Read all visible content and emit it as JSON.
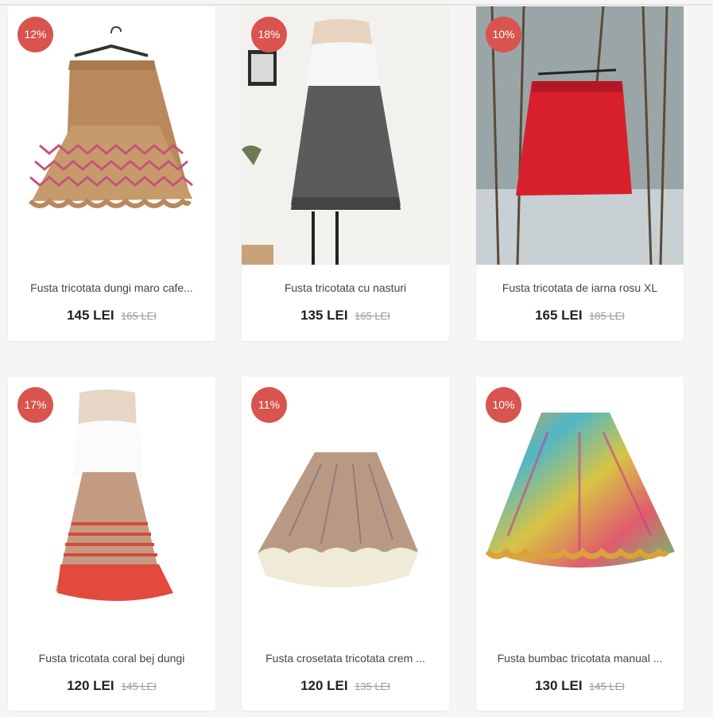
{
  "products": [
    {
      "discount": "12%",
      "title": "Fusta tricotata dungi maro cafe...",
      "price": "145 LEI",
      "old_price": "165 LEI"
    },
    {
      "discount": "18%",
      "title": "Fusta tricotata cu nasturi",
      "price": "135 LEI",
      "old_price": "165 LEI"
    },
    {
      "discount": "10%",
      "title": "Fusta tricotata de iarna rosu XL",
      "price": "165 LEI",
      "old_price": "185 LEI"
    },
    {
      "discount": "17%",
      "title": "Fusta tricotata coral bej dungi",
      "price": "120 LEI",
      "old_price": "145 LEI"
    },
    {
      "discount": "11%",
      "title": "Fusta crosetata tricotata crem ...",
      "price": "120 LEI",
      "old_price": "135 LEI"
    },
    {
      "discount": "10%",
      "title": "Fusta bumbac tricotata manual ...",
      "price": "130 LEI",
      "old_price": "145 LEI"
    }
  ]
}
